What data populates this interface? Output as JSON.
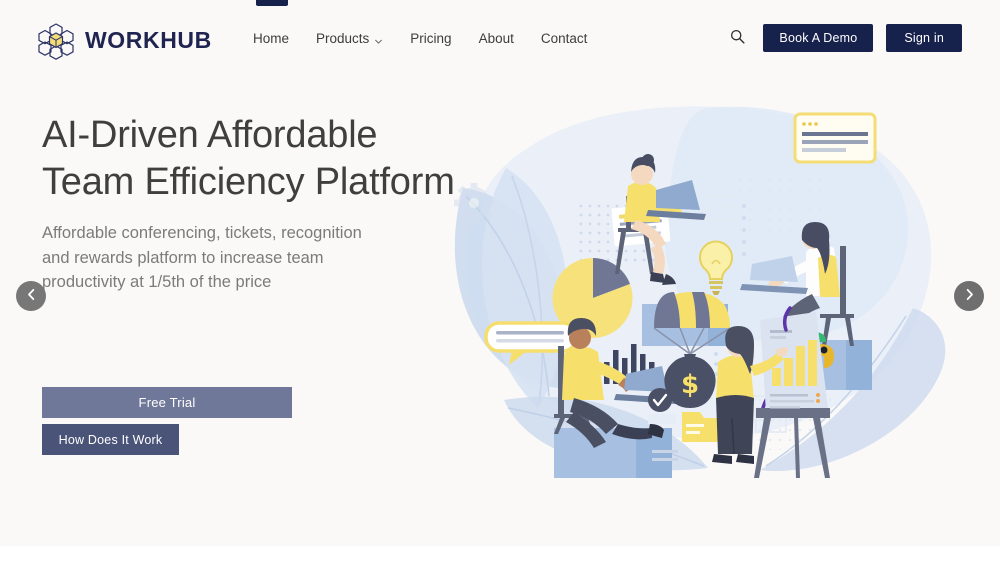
{
  "brand": {
    "name": "WORKHUB",
    "logo_icon": "cube-cluster-logo",
    "accent": "#1f2450",
    "accent_yellow": "#f4dd79"
  },
  "nav": {
    "items": [
      {
        "label": "Home",
        "has_caret": false
      },
      {
        "label": "Products",
        "has_caret": true
      },
      {
        "label": "Pricing",
        "has_caret": false
      },
      {
        "label": "About",
        "has_caret": false
      },
      {
        "label": "Contact",
        "has_caret": false
      }
    ],
    "search_icon": "search-icon",
    "book_demo_label": "Book A Demo",
    "signin_label": "Sign in",
    "button_bg": "#16214c"
  },
  "hero": {
    "headline": "AI-Driven Affordable Team Efficiency Platform",
    "subhead": "Affordable conferencing, tickets, recognition and rewards platform to increase team productivity at 1/5th of the price",
    "primary_cta": "Free Trial",
    "secondary_cta": "How Does It Work",
    "primary_cta_bg": "#6f7899",
    "secondary_cta_bg": "#4a5378",
    "background": "#faf9f7"
  },
  "carousel": {
    "prev_icon": "chevron-left-icon",
    "next_icon": "chevron-right-icon",
    "arrow_bg": "#777777"
  },
  "illustration": {
    "alt": "team collaboration illustration",
    "elements": [
      "leaf-shapes",
      "gear-icon",
      "pie-chart",
      "bar-chart",
      "speech-bubble",
      "document-card",
      "lightbulb-icon",
      "parachute-money-bag",
      "checkmark-badge",
      "pinwheel-logo",
      "flipchart-bar-chart",
      "person-on-laptop",
      "person-at-whiteboard"
    ],
    "palette": {
      "blue": "#a8bfe0",
      "pale_blue": "#dbe5f3",
      "yellow": "#f5de6e",
      "dark": "#5a5e73"
    }
  }
}
